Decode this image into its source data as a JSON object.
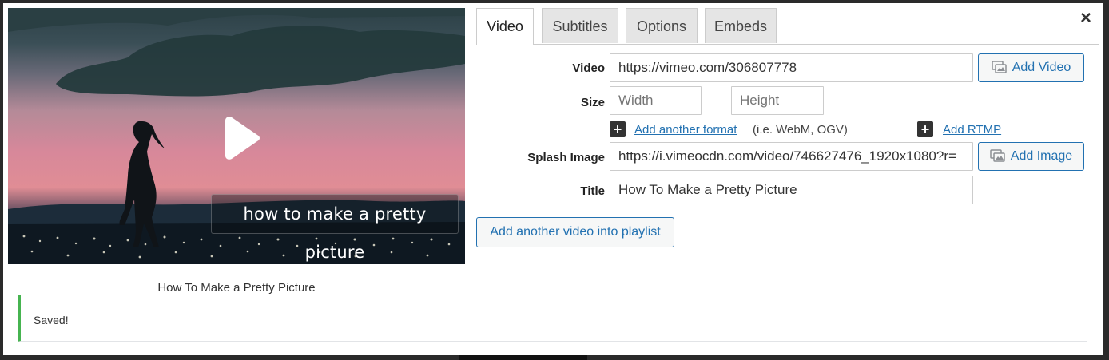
{
  "tabs": [
    {
      "label": "Video"
    },
    {
      "label": "Subtitles"
    },
    {
      "label": "Options"
    },
    {
      "label": "Embeds"
    }
  ],
  "close_symbol": "×",
  "preview": {
    "caption": "how to make a pretty picture",
    "title": "How To Make a Pretty Picture"
  },
  "form": {
    "video_label": "Video",
    "video_value": "https://vimeo.com/306807778",
    "add_video_label": "Add Video",
    "size_label": "Size",
    "width_placeholder": "Width",
    "height_placeholder": "Height",
    "add_format_link": "Add another format",
    "add_format_hint": "(i.e. WebM, OGV)",
    "add_rtmp_link": "Add RTMP",
    "splash_label": "Splash Image",
    "splash_value": "https://i.vimeocdn.com/video/746627476_1920x1080?r=",
    "add_image_label": "Add Image",
    "title_label": "Title",
    "title_value": "How To Make a Pretty Picture",
    "add_playlist_label": "Add another video into playlist"
  },
  "notice": {
    "text": "Saved!"
  },
  "colors": {
    "accent": "#2271b1",
    "success": "#46b450"
  },
  "icons": [
    "close-icon",
    "play-icon",
    "media-library-icon",
    "plus-icon"
  ]
}
